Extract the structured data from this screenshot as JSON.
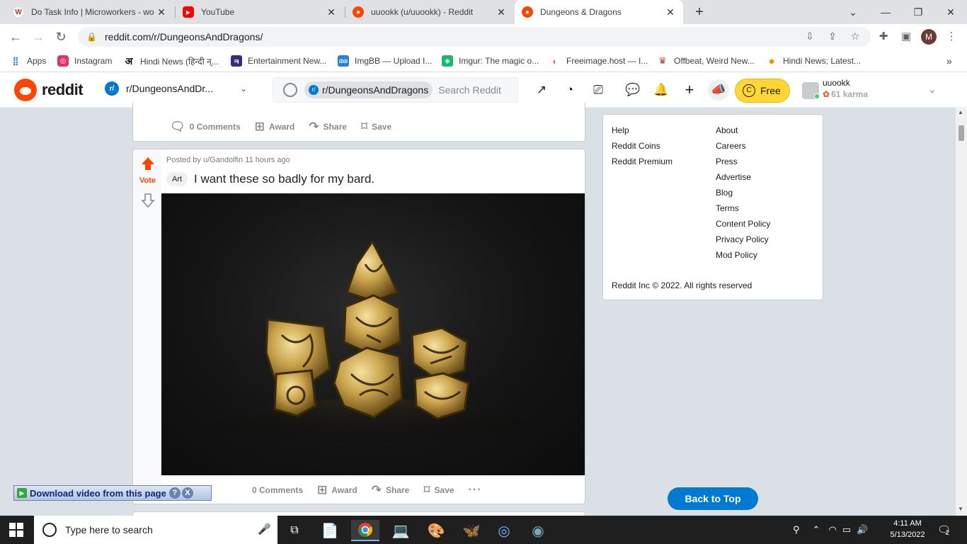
{
  "browser": {
    "tabs": [
      {
        "title": "Do Task Info | Microworkers - wo",
        "favicon": "microworkers-icon",
        "color": "#D8252C",
        "glyph": "W"
      },
      {
        "title": "YouTube",
        "favicon": "youtube-icon",
        "color": "#FF0000",
        "glyph": "▶"
      },
      {
        "title": "uuookk (u/uuookk) - Reddit",
        "favicon": "reddit-icon",
        "color": "#FF4500",
        "glyph": "●"
      },
      {
        "title": "Dungeons & Dragons",
        "favicon": "reddit-icon",
        "color": "#FF4500",
        "glyph": "●"
      }
    ],
    "active_tab": 3,
    "url": "reddit.com/r/DungeonsAndDragons/",
    "profile_initial": "M",
    "bookmarks": [
      {
        "label": "Apps",
        "icon": "apps-grid-icon",
        "color": "#4285F4",
        "glyph": "⋮⋮"
      },
      {
        "label": "Instagram",
        "icon": "instagram-icon",
        "color": "#E1306C",
        "glyph": "◎"
      },
      {
        "label": "Hindi News (हिन्दी न्...",
        "icon": "amar-ujala-icon",
        "color": "#111111",
        "glyph": "अ"
      },
      {
        "label": "Entertainment New...",
        "icon": "news-icon",
        "color": "#3b2a7a",
        "glyph": "ㅋ"
      },
      {
        "label": "ImgBB — Upload I...",
        "icon": "imgbb-icon",
        "color": "#2a7de1",
        "glyph": "ibb"
      },
      {
        "label": "Imgur: The magic o...",
        "icon": "imgur-icon",
        "color": "#1bb76e",
        "glyph": "◈"
      },
      {
        "label": "Freeimage.host — I...",
        "icon": "freeimage-icon",
        "color": "#e86a6a",
        "glyph": "◐"
      },
      {
        "label": "Offbeat, Weird New...",
        "icon": "offbeat-icon",
        "color": "#b23b3b",
        "glyph": "♛"
      },
      {
        "label": "Hindi News; Latest...",
        "icon": "hindi-news-icon",
        "color": "#ff8c00",
        "glyph": "●"
      }
    ]
  },
  "reddit_header": {
    "wordmark": "reddit",
    "community": "r/DungeonsAndDr...",
    "search_pill": "r/DungeonsAndDragons",
    "search_placeholder": "Search Reddit",
    "free_label": "Free",
    "username": "uuookk",
    "karma": "61 karma"
  },
  "prev_post": {
    "comments": "0 Comments",
    "award": "Award",
    "share": "Share",
    "save": "Save"
  },
  "post": {
    "meta": "Posted by u/Gandolfin 11 hours ago",
    "vote_label": "Vote",
    "flair": "Art",
    "title": "I want these so badly for my bard.",
    "comments": "0 Comments",
    "award": "Award",
    "share": "Share",
    "save": "Save",
    "more": "···"
  },
  "sidebar": {
    "col1": [
      "Help",
      "Reddit Coins",
      "Reddit Premium"
    ],
    "col2": [
      "About",
      "Careers",
      "Press",
      "Advertise",
      "Blog",
      "Terms",
      "Content Policy",
      "Privacy Policy",
      "Mod Policy"
    ],
    "copyright": "Reddit Inc © 2022. All rights reserved"
  },
  "back_to_top": "Back to Top",
  "download_bar": {
    "label": "Download video from this page",
    "help": "?",
    "close": "X"
  },
  "taskbar": {
    "search_placeholder": "Type here to search",
    "time": "4:11 AM",
    "date": "5/13/2022",
    "notifications": "2"
  }
}
